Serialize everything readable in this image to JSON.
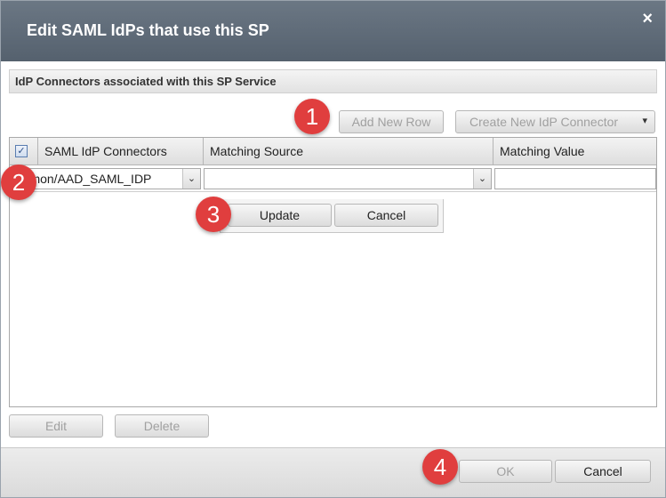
{
  "dialog": {
    "title": "Edit SAML IdPs that use this SP",
    "close_glyph": "×"
  },
  "section": {
    "header": "IdP Connectors associated with this SP Service"
  },
  "toolbar": {
    "add_new_row_label": "Add New Row",
    "create_connector_label": "Create New IdP Connector",
    "create_connector_arrow": "▾"
  },
  "grid": {
    "select_all_checked": true,
    "checkbox_glyph": "✓",
    "columns": [
      "SAML IdP Connectors",
      "Matching Source",
      "Matching Value"
    ],
    "edit_row": {
      "connector_value": "/Common/AAD_SAML_IDP",
      "matching_source_value": "",
      "matching_value": "",
      "dropdown_glyph": "⌄"
    }
  },
  "row_editor": {
    "update_label": "Update",
    "cancel_label": "Cancel"
  },
  "grid_actions": {
    "edit_label": "Edit",
    "delete_label": "Delete"
  },
  "footer": {
    "ok_label": "OK",
    "cancel_label": "Cancel"
  },
  "callouts": [
    "1",
    "2",
    "3",
    "4"
  ],
  "colors": {
    "titlebar": "#5f6b78",
    "callout": "#e03e3e",
    "disabled_text": "#a0a0a0"
  }
}
